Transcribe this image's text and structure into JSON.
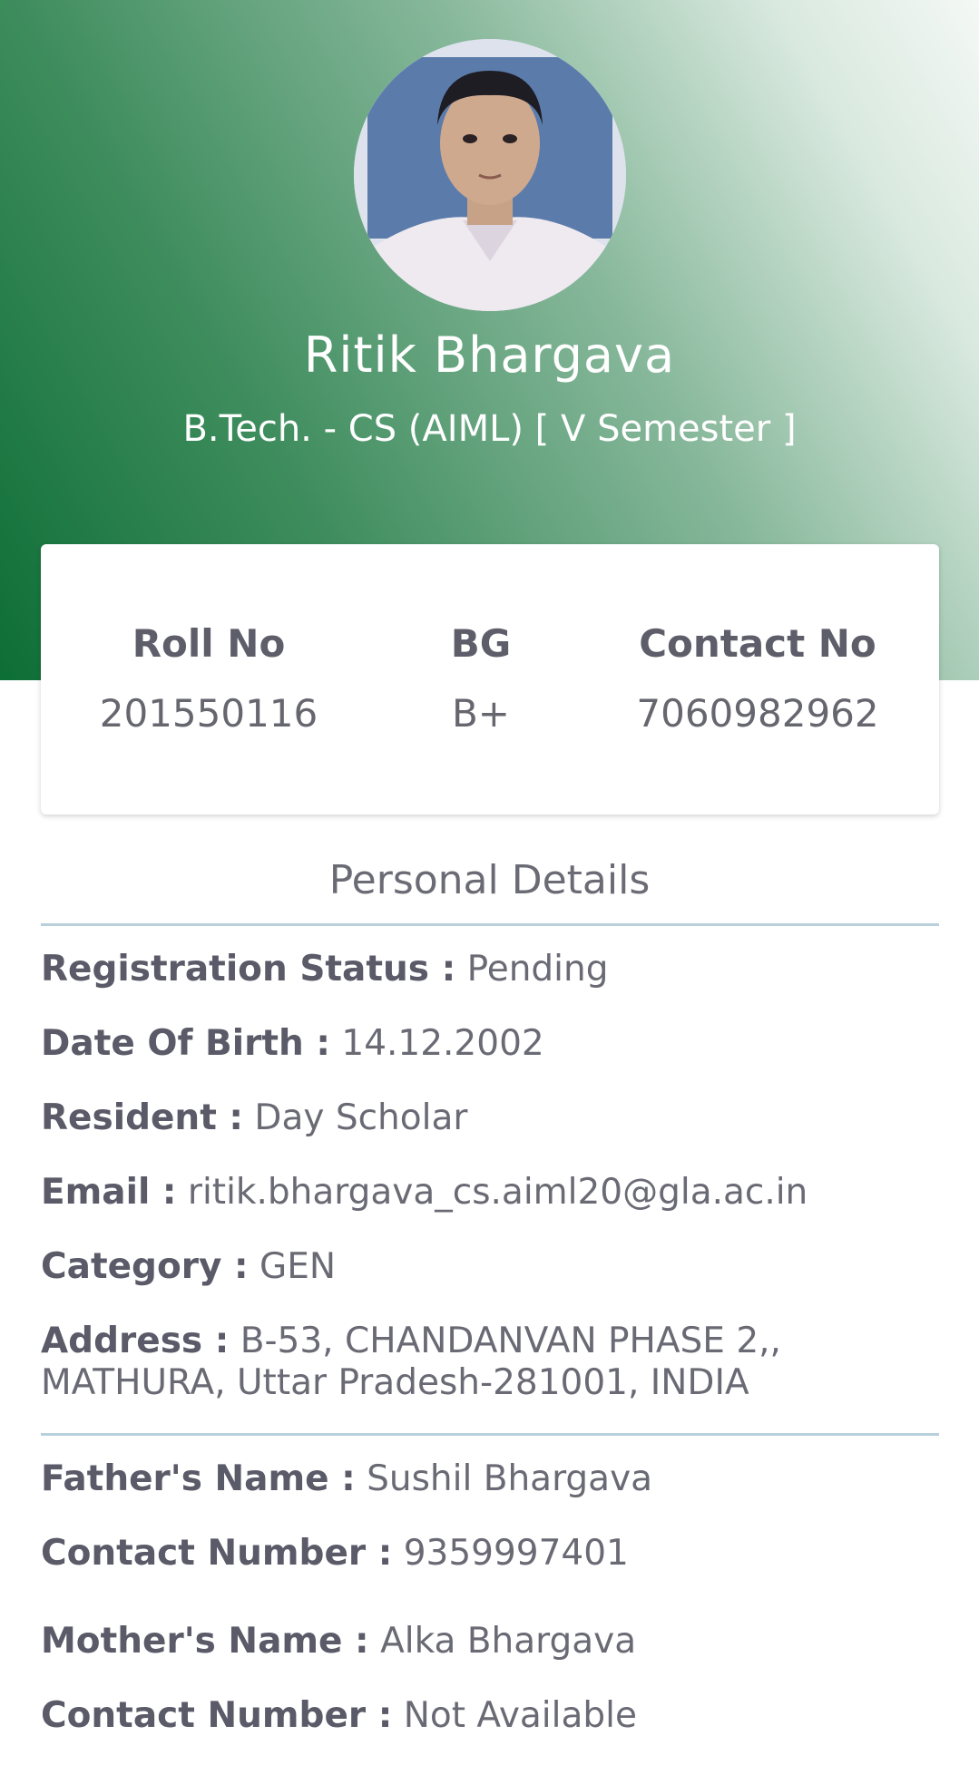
{
  "profile": {
    "name": "Ritik Bhargava",
    "program": "B.Tech. - CS (AIML) [ V Semester ]"
  },
  "stats": {
    "roll_label": "Roll No",
    "roll_value": "201550116",
    "bg_label": "BG",
    "bg_value": "B+",
    "contact_label": "Contact No",
    "contact_value": "7060982962"
  },
  "section_title": "Personal Details",
  "details": {
    "registration_label": "Registration Status :",
    "registration_value": "Pending",
    "dob_label": "Date Of Birth :",
    "dob_value": "14.12.2002",
    "resident_label": "Resident :",
    "resident_value": "Day Scholar",
    "email_label": "Email :",
    "email_value": "ritik.bhargava_cs.aiml20@gla.ac.in",
    "category_label": "Category :",
    "category_value": "GEN",
    "address_label": "Address :",
    "address_value": "B-53, CHANDANVAN PHASE 2,, MATHURA, Uttar Pradesh-281001, INDIA"
  },
  "family": {
    "father_label": "Father's Name :",
    "father_value": "Sushil Bhargava",
    "father_contact_label": "Contact Number :",
    "father_contact_value": "9359997401",
    "mother_label": "Mother's Name :",
    "mother_value": "Alka Bhargava",
    "mother_contact_label": "Contact Number :",
    "mother_contact_value": "Not Available"
  },
  "colors": {
    "header_dark": "#0d6e35",
    "header_light": "#f4f8f5",
    "divider": "#b8cfdc",
    "text": "#60606c"
  }
}
